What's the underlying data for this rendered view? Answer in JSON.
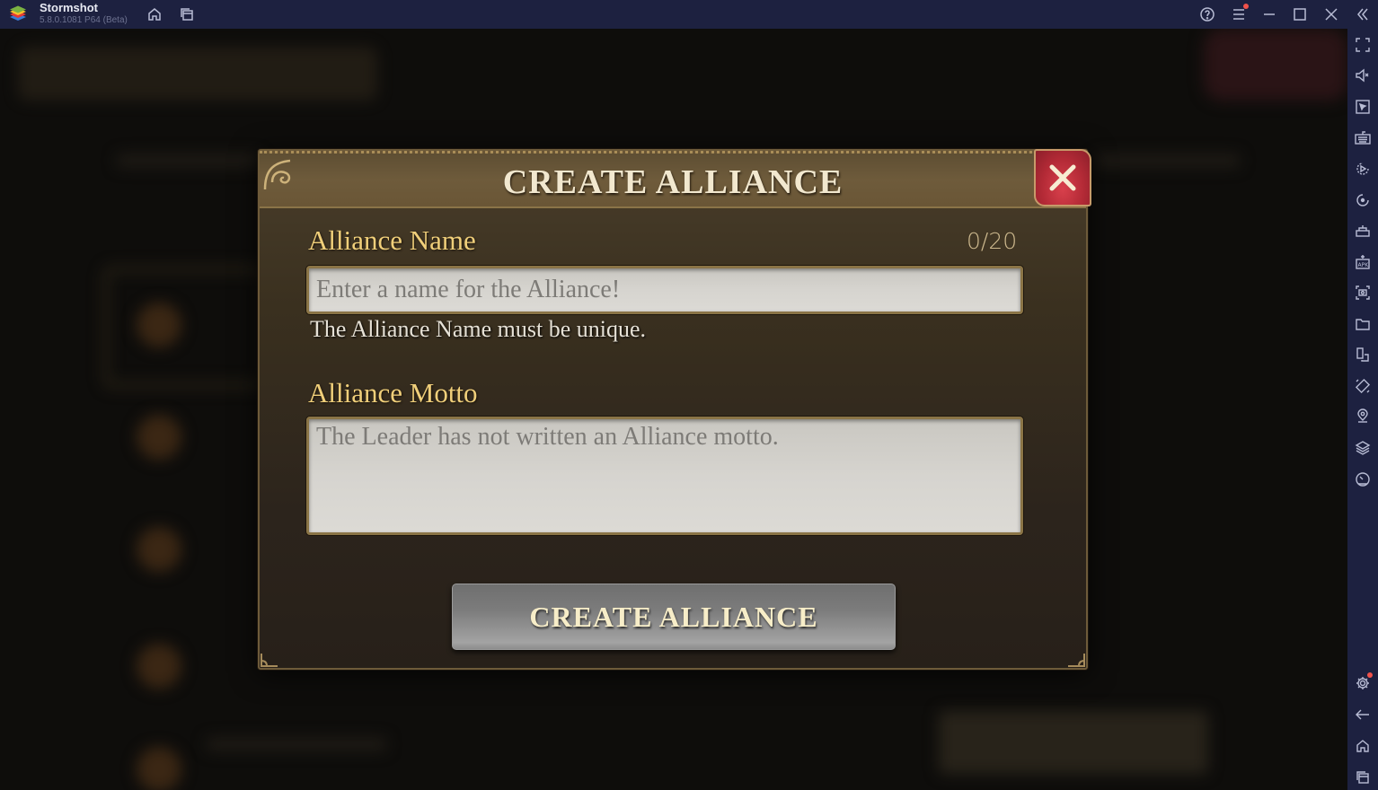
{
  "window": {
    "app_name": "Stormshot",
    "app_version": "5.8.0.1081 P64 (Beta)",
    "titlebar_buttons": [
      {
        "name": "home-icon"
      },
      {
        "name": "multi-instance-icon"
      },
      {
        "name": "help-icon"
      },
      {
        "name": "menu-icon",
        "has_notification": true
      },
      {
        "name": "minimize-icon"
      },
      {
        "name": "maximize-icon"
      },
      {
        "name": "close-window-icon"
      },
      {
        "name": "collapse-sidebar-icon"
      }
    ]
  },
  "sidebar": {
    "tools": [
      {
        "name": "fullscreen-icon"
      },
      {
        "name": "volume-mute-icon"
      },
      {
        "name": "pointer-icon"
      },
      {
        "name": "keyboard-icon"
      },
      {
        "name": "macro-record-icon"
      },
      {
        "name": "sync-icon"
      },
      {
        "name": "game-controls-icon"
      },
      {
        "name": "install-apk-icon"
      },
      {
        "name": "screenshot-icon"
      },
      {
        "name": "folder-icon"
      },
      {
        "name": "multi-window-icon"
      },
      {
        "name": "rotate-icon"
      },
      {
        "name": "location-icon"
      },
      {
        "name": "layers-icon"
      },
      {
        "name": "performance-icon"
      }
    ],
    "bottom_tools": [
      {
        "name": "settings-icon",
        "has_notification": true
      },
      {
        "name": "back-icon"
      },
      {
        "name": "android-home-icon"
      },
      {
        "name": "recent-apps-icon"
      }
    ]
  },
  "dialog": {
    "title": "CREATE ALLIANCE",
    "name_field": {
      "label": "Alliance Name",
      "counter": "0/20",
      "value": "",
      "placeholder": "Enter a name for the Alliance!",
      "hint": "The Alliance Name must be unique."
    },
    "motto_field": {
      "label": "Alliance Motto",
      "value": "",
      "placeholder": "The Leader has not written an Alliance motto."
    },
    "submit_label": "CREATE ALLIANCE"
  },
  "colors": {
    "titlebar_bg": "#1d2140",
    "label_gold": "#f0cf7a",
    "close_red": "#b32a36",
    "notification": "#f0524b"
  }
}
